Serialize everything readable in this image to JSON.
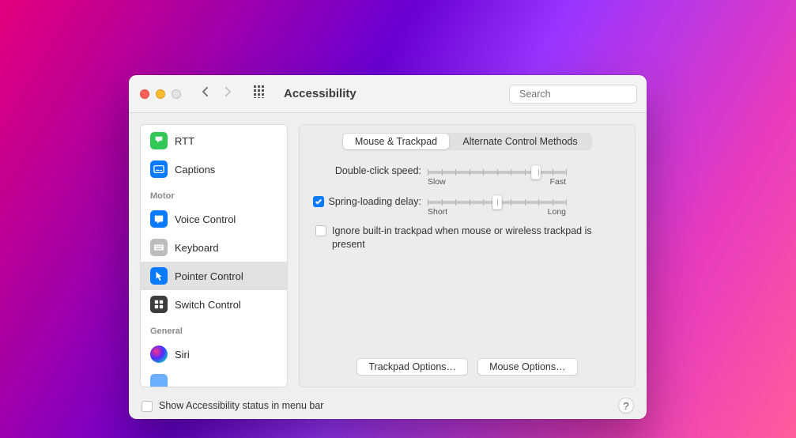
{
  "header": {
    "title": "Accessibility",
    "search_placeholder": "Search"
  },
  "sidebar": {
    "hearing_partial": [
      {
        "label": "RTT",
        "icon": "rtt-icon",
        "color": "green"
      },
      {
        "label": "Captions",
        "icon": "captions-icon",
        "color": "blue"
      }
    ],
    "motor_label": "Motor",
    "motor": [
      {
        "label": "Voice Control",
        "icon": "voice-control-icon",
        "color": "blue"
      },
      {
        "label": "Keyboard",
        "icon": "keyboard-icon",
        "color": "gray"
      },
      {
        "label": "Pointer Control",
        "icon": "pointer-control-icon",
        "color": "blue",
        "selected": true
      },
      {
        "label": "Switch Control",
        "icon": "switch-control-icon",
        "color": "dark"
      }
    ],
    "general_label": "General",
    "general": [
      {
        "label": "Siri",
        "icon": "siri-icon",
        "color": "siri"
      }
    ]
  },
  "tabs": {
    "active": "Mouse & Trackpad",
    "inactive": "Alternate Control Methods"
  },
  "settings": {
    "double_click": {
      "label": "Double-click speed:",
      "min_label": "Slow",
      "max_label": "Fast",
      "value": 0.78,
      "ticks": 10
    },
    "spring_loading": {
      "checked": true,
      "label": "Spring-loading delay:",
      "min_label": "Short",
      "max_label": "Long",
      "value": 0.5,
      "ticks": 10
    },
    "ignore_trackpad": {
      "checked": false,
      "label": "Ignore built-in trackpad when mouse or wireless trackpad is present"
    },
    "trackpad_options_label": "Trackpad Options…",
    "mouse_options_label": "Mouse Options…"
  },
  "footer": {
    "status_label": "Show Accessibility status in menu bar",
    "status_checked": false
  }
}
